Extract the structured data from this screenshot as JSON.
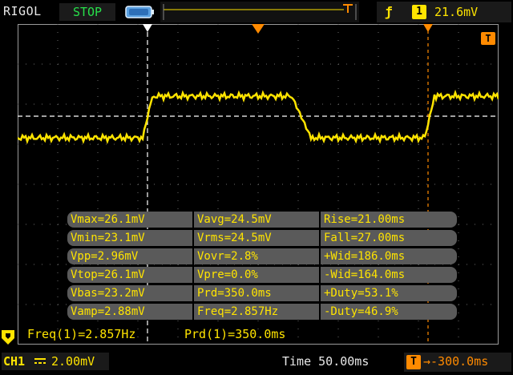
{
  "top": {
    "brand": "RIGOL",
    "run_state": "STOP",
    "trigger_type_icon": "rising-edge-icon",
    "trigger_source": "1",
    "trigger_level": "21.6mV"
  },
  "bottom": {
    "channel": "CH1",
    "coupling_icon": "dc-coupling-icon",
    "volts_per_div": "2.00mV",
    "time_label": "Time",
    "time_per_div": "50.00ms",
    "trigger_offset_label": "T",
    "trigger_offset": "-300.0ms"
  },
  "markers": {
    "trigger_position_label": "T"
  },
  "measurements": [
    [
      "Vmax=26.1mV",
      "Vavg=24.5mV",
      "Rise=21.00ms"
    ],
    [
      "Vmin=23.1mV",
      "Vrms=24.5mV",
      "Fall=27.00ms"
    ],
    [
      "Vpp=2.96mV",
      "Vovr=2.8%",
      "+Wid=186.0ms"
    ],
    [
      "Vtop=26.1mV",
      "Vpre=0.0%",
      "-Wid=164.0ms"
    ],
    [
      "Vbas=23.2mV",
      "Prd=350.0ms",
      "+Duty=53.1%"
    ],
    [
      "Vamp=2.88mV",
      "Freq=2.857Hz",
      "-Duty=46.9%"
    ]
  ],
  "counters": {
    "freq": "Freq(1)=2.857Hz",
    "period": "Prd(1)=350.0ms"
  },
  "colors": {
    "trace": "#ffe400",
    "trigger": "#ff8a00",
    "grid": "#9a9a9a",
    "background": "#000000"
  }
}
